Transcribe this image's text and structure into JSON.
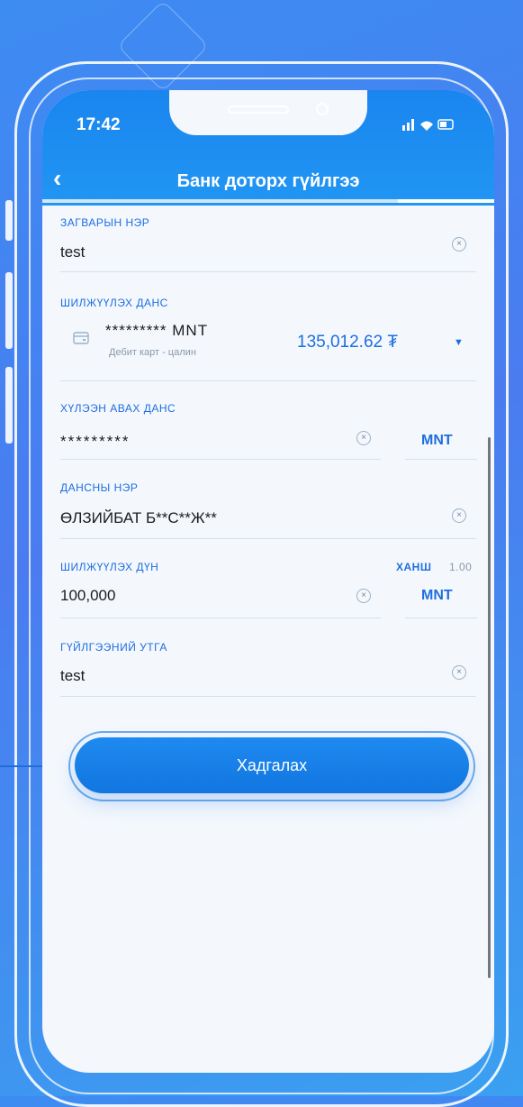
{
  "status_bar": {
    "time": "17:42",
    "icons": "▐▐ ● ▭"
  },
  "header": {
    "back_icon": "‹",
    "title": "Банк доторх гүйлгээ"
  },
  "form": {
    "template_name": {
      "label": "ЗАГВАРЫН НЭР",
      "value": "test"
    },
    "from_account": {
      "label": "ШИЛЖҮҮЛЭХ ДАНС",
      "account": "********* MNT",
      "description": "Дебит карт - цалин",
      "balance": "135,012.62 ₮",
      "dropdown_icon": "▼"
    },
    "to_account": {
      "label": "ХҮЛЭЭН АВАХ ДАНС",
      "value": "*********",
      "currency": "MNT"
    },
    "account_name": {
      "label": "ДАНСНЫ НЭР",
      "value": "ӨЛЗИЙБАТ Б**С**Ж**"
    },
    "amount": {
      "label": "ШИЛЖҮҮЛЭХ ДҮН",
      "rate_label": "ХАНШ",
      "rate_value": "1.00",
      "value": "100,000",
      "currency": "MNT"
    },
    "description": {
      "label": "ГҮЙЛГЭЭНИЙ УТГА",
      "value": "test"
    }
  },
  "save_button": {
    "label": "Хадгалах"
  },
  "clear_icon": "×"
}
